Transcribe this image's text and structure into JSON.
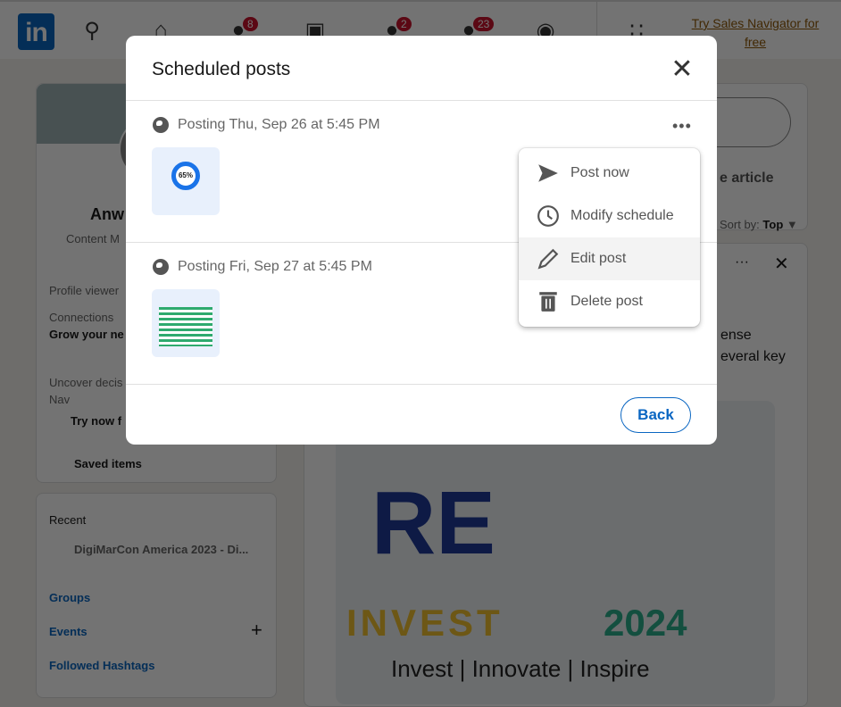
{
  "nav": {
    "logo": "in",
    "badges": {
      "network": "8",
      "messaging": "2",
      "notifications": "23"
    },
    "sales_navigator": "Try Sales Navigator for free"
  },
  "left": {
    "name": "Anw",
    "headline": "Content M",
    "profile_viewers": "Profile viewer",
    "connections": "Connections",
    "grow": "Grow your ne",
    "uncover": "Uncover decis",
    "nav": "Nav",
    "try_now": "Try now f",
    "saved_items": "Saved items",
    "recent": "Recent",
    "recent_item": "DigiMarCon America 2023 - Di...",
    "groups": "Groups",
    "events": "Events",
    "hashtags": "Followed Hashtags"
  },
  "right": {
    "article": "e article",
    "sort_label": "Sort by:",
    "sort_value": "Top",
    "text1": "ense",
    "text2": "everal key",
    "image_text": {
      "logo": "RE",
      "invest": "INVEST",
      "year": "2024",
      "tagline": "Invest | Innovate | Inspire"
    }
  },
  "modal": {
    "title": "Scheduled posts",
    "posts": [
      {
        "when": "Posting Thu, Sep 26 at 5:45 PM",
        "thumb_text": "65%"
      },
      {
        "when": "Posting Fri, Sep 27 at 5:45 PM"
      }
    ],
    "menu": [
      {
        "label": "Post now",
        "icon": "send-icon"
      },
      {
        "label": "Modify schedule",
        "icon": "clock-icon"
      },
      {
        "label": "Edit post",
        "icon": "pencil-icon",
        "highlighted": true
      },
      {
        "label": "Delete post",
        "icon": "trash-icon"
      }
    ],
    "back": "Back"
  },
  "colors": {
    "brand": "#0a66c2",
    "badge": "#cb112d",
    "overlay": "rgba(0,0,0,0.55)"
  }
}
